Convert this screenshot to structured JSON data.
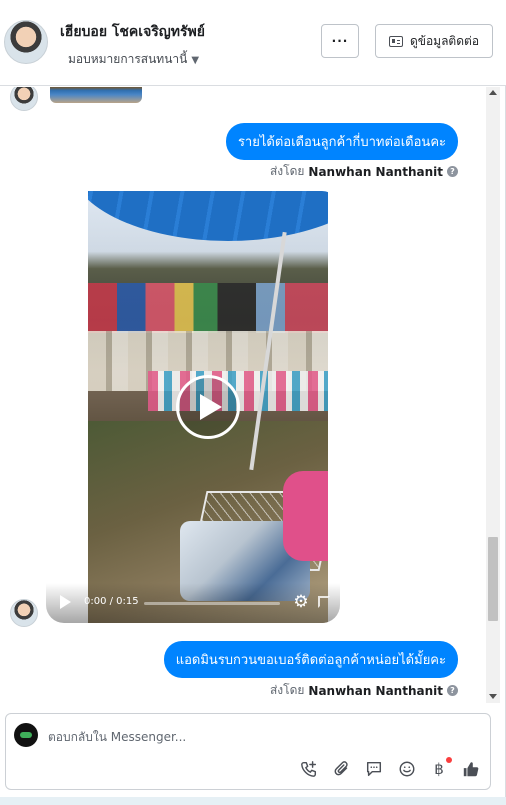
{
  "header": {
    "contact_name": "เฮียบอย โชคเจริญทรัพย์",
    "assign_label": "มอบหมายการสนทนานี้",
    "more_label": "···",
    "contact_info_label": "ดูข้อมูลติดต่อ"
  },
  "conversation": {
    "messages": [
      {
        "type": "text",
        "text": "รายได้ต่อเดือนลูกค้ากี่บาทต่อเดือนคะ",
        "sent_by_prefix": "ส่งโดย",
        "sent_by_name": "Nanwhan Nanthanit"
      },
      {
        "type": "video",
        "time": "0:00 / 0:15",
        "progress": 0.0
      },
      {
        "type": "text",
        "text": "แอดมินรบกวนขอเบอร์ติดต่อลูกค้าหน่อยได้มั้ยคะ",
        "sent_by_prefix": "ส่งโดย",
        "sent_by_name": "Nanwhan Nanthanit"
      }
    ]
  },
  "composer": {
    "placeholder": "ตอบกลับใน Messenger...",
    "tools": [
      "phone-plus-icon",
      "paperclip-icon",
      "chat-bubble-icon",
      "smiley-icon",
      "baht-icon",
      "thumbs-up-icon"
    ]
  },
  "colors": {
    "bubble": "#0084ff",
    "text": "#1c1e21",
    "secondary_text": "#606770",
    "border": "#dadde1"
  }
}
